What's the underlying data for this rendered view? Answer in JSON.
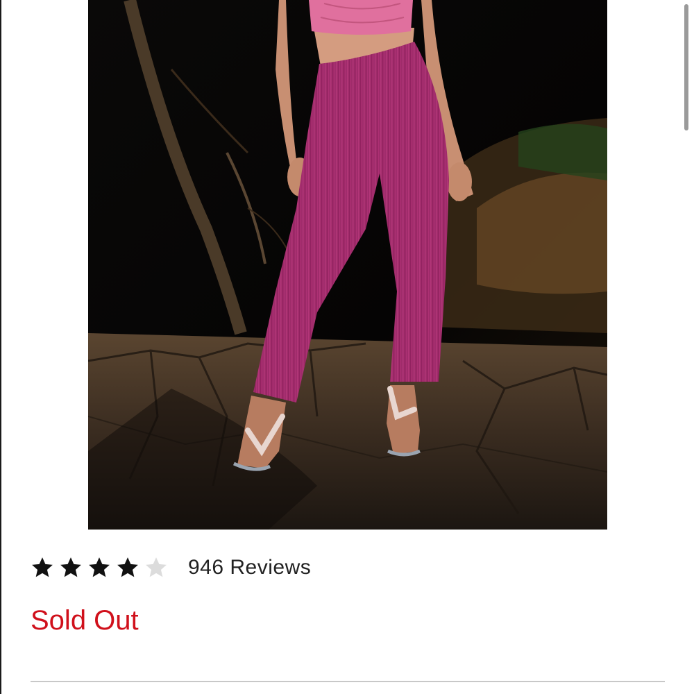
{
  "product": {
    "image_alt": "Model wearing pink ribbed flare pants and pink cropped top on a stone path",
    "rating": {
      "value": 4,
      "max": 5
    },
    "review_count_label": "946 Reviews",
    "availability_label": "Sold Out"
  },
  "colors": {
    "sold_out": "#d0101b",
    "star_filled": "#111111",
    "star_empty": "#dcdcdc",
    "pants": "#b83478"
  }
}
